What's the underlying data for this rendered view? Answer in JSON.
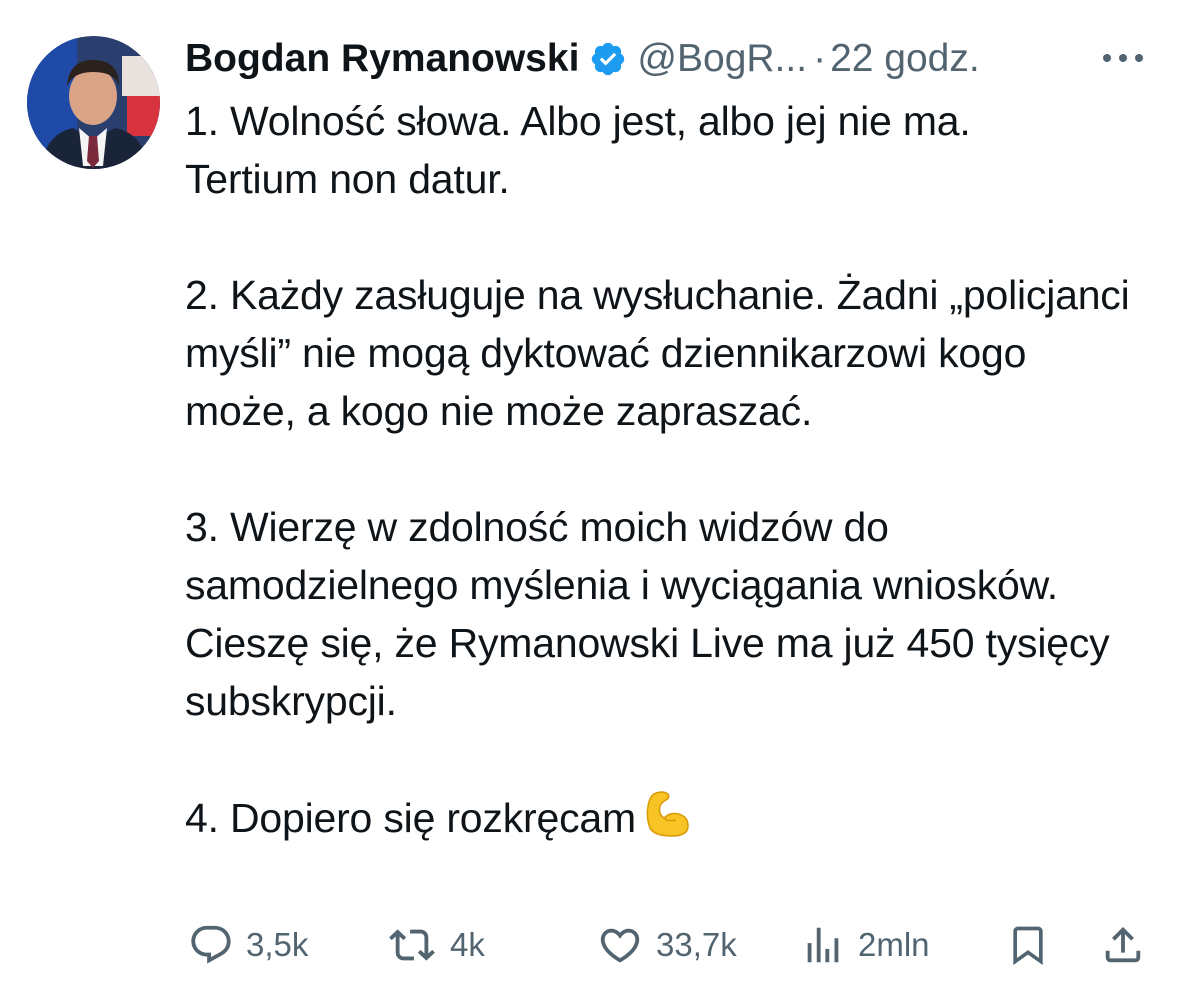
{
  "author": {
    "name": "Bogdan Rymanowski",
    "handle": "@BogR...",
    "separator": "·",
    "time": "22 godz.",
    "avatar_icon": "portrait-avatar",
    "verified_icon": "verified-badge-icon"
  },
  "tweet": {
    "text": "1. Wolność słowa. Albo jest, albo jej nie ma.\nTertium non datur.\n\n2. Każdy zasługuje na wysłuchanie. Żadni „policjanci myśli” nie mogą dyktować dziennikarzowi kogo może, a kogo nie może zapraszać.\n\n3. Wierzę w zdolność moich widzów do samodzielnego myślenia i wyciągania wniosków. Cieszę się, że Rymanowski Live ma już 450 tysięcy subskrypcji.\n\n4. Dopiero się rozkręcam",
    "emoji_icon": "flexed-biceps-emoji"
  },
  "actions": {
    "reply_count": "3,5k",
    "retweet_count": "4k",
    "like_count": "33,7k",
    "views_count": "2mln"
  },
  "colors": {
    "text": "#0f1419",
    "secondary": "#536471",
    "verified": "#1d9bf0"
  }
}
